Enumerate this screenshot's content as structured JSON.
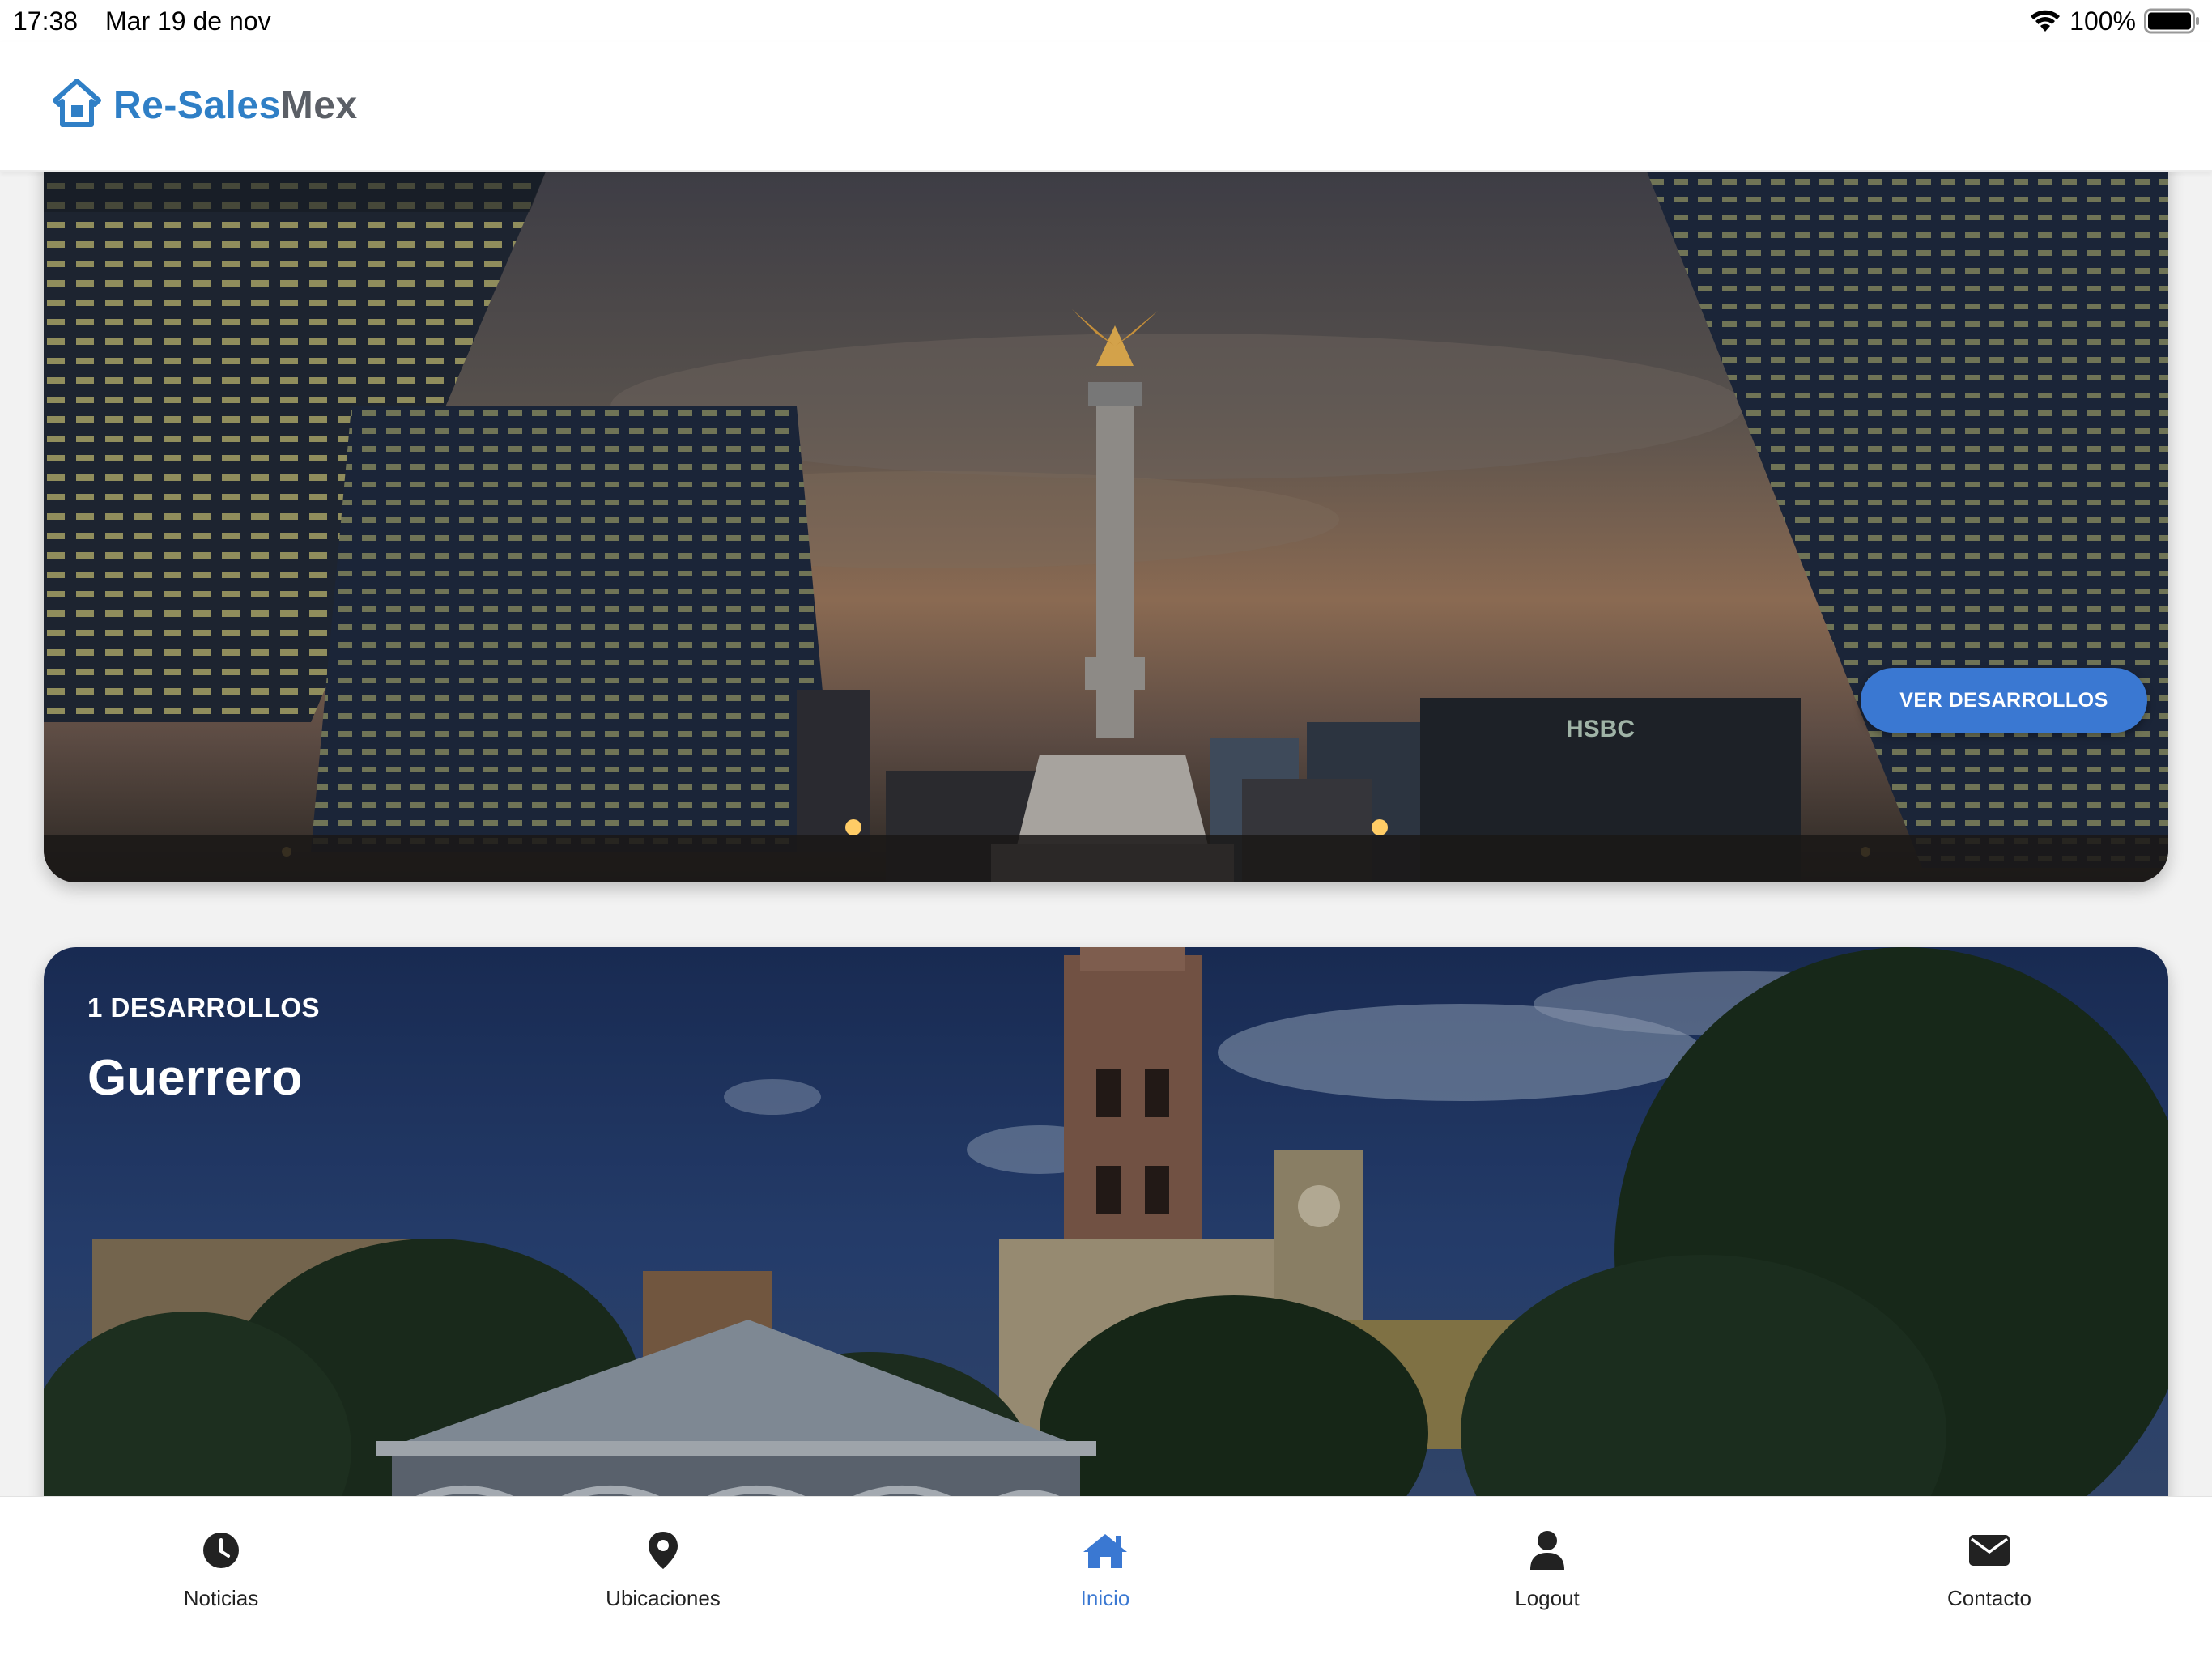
{
  "status_bar": {
    "time": "17:38",
    "date": "Mar 19 de nov",
    "battery": "100%"
  },
  "header": {
    "logo_part1": "Re-Sales",
    "logo_part2": "Mex",
    "brand_color": "#2f7fc6"
  },
  "cards": [
    {
      "image": "night-cityscape-angel-monument",
      "button_label": "VER DESARROLLOS"
    },
    {
      "image": "colonial-church-plaza",
      "count": "1 DESARROLLOS",
      "title": "Guerrero"
    }
  ],
  "tab_bar": {
    "accent_color": "#3a78d2",
    "active_tab": "Inicio",
    "tabs": [
      {
        "label": "Noticias",
        "icon": "clock-icon"
      },
      {
        "label": "Ubicaciones",
        "icon": "map-pin-icon"
      },
      {
        "label": "Inicio",
        "icon": "home-icon"
      },
      {
        "label": "Logout",
        "icon": "user-icon"
      },
      {
        "label": "Contacto",
        "icon": "envelope-icon"
      }
    ]
  }
}
